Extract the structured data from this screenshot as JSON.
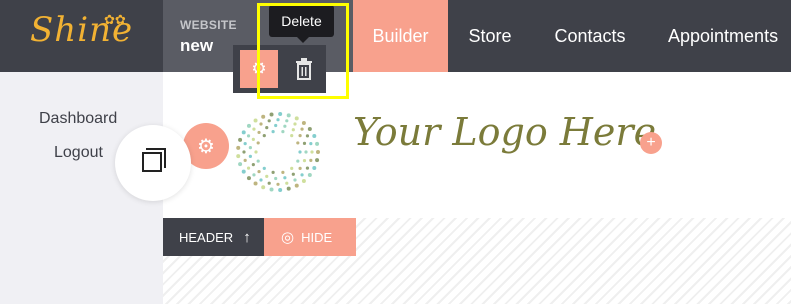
{
  "brand": {
    "name": "Shine",
    "flowers": "✿✿"
  },
  "website": {
    "label": "WEBSITE",
    "name": "new"
  },
  "nav": {
    "builder": "Builder",
    "store": "Store",
    "contacts": "Contacts",
    "appointments": "Appointments"
  },
  "sidebar": {
    "dashboard": "Dashboard",
    "logout": "Logout"
  },
  "toolbar": {
    "tooltip": "Delete",
    "gear_icon": "gear-icon",
    "trash_icon": "trash-icon"
  },
  "logo": {
    "text": "Your Logo Here"
  },
  "section": {
    "label": "HEADER",
    "arrow": "↑",
    "hide_label": "HIDE"
  },
  "colors": {
    "accent": "#f8a18d",
    "topbar": "#3f4149",
    "highlight": "#ffff00",
    "brand": "#f2b233",
    "logo_text": "#7b7b3a"
  }
}
